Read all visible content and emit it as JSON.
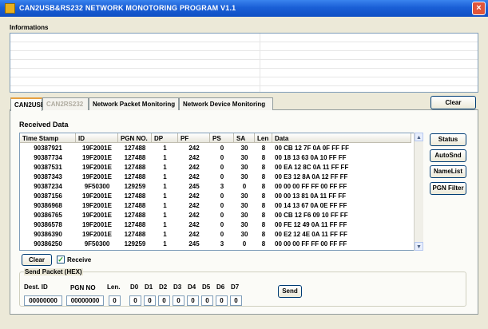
{
  "window": {
    "title": "CAN2USB&RS232 NETWORK MONOTORING PROGRAM V1.1",
    "close_glyph": "×"
  },
  "info": {
    "label": "Informations",
    "clear_label": "Clear"
  },
  "tabs": [
    {
      "label": "CAN2USB",
      "state": "active"
    },
    {
      "label": "CAN2RS232",
      "state": "disabled"
    },
    {
      "label": "Network Packet Monitoring",
      "state": "normal"
    },
    {
      "label": "Network Device Monitoring",
      "state": "normal"
    }
  ],
  "received": {
    "label": "Received Data",
    "columns": [
      "Time Stamp",
      "ID",
      "PGN NO.",
      "DP",
      "PF",
      "PS",
      "SA",
      "Len",
      "Data"
    ],
    "rows": [
      [
        "90387921",
        "19F2001E",
        "127488",
        "1",
        "242",
        "0",
        "30",
        "8",
        "00 CB 12 7F 0A 0F FF FF"
      ],
      [
        "90387734",
        "19F2001E",
        "127488",
        "1",
        "242",
        "0",
        "30",
        "8",
        "00 18 13 63 0A 10 FF FF"
      ],
      [
        "90387531",
        "19F2001E",
        "127488",
        "1",
        "242",
        "0",
        "30",
        "8",
        "00 EA 12 8C 0A 11 FF FF"
      ],
      [
        "90387343",
        "19F2001E",
        "127488",
        "1",
        "242",
        "0",
        "30",
        "8",
        "00 E3 12 8A 0A 12 FF FF"
      ],
      [
        "90387234",
        "9F50300",
        "129259",
        "1",
        "245",
        "3",
        "0",
        "8",
        "00 00 00 FF FF 00 FF FF"
      ],
      [
        "90387156",
        "19F2001E",
        "127488",
        "1",
        "242",
        "0",
        "30",
        "8",
        "00 00 13 81 0A 11 FF FF"
      ],
      [
        "90386968",
        "19F2001E",
        "127488",
        "1",
        "242",
        "0",
        "30",
        "8",
        "00 14 13 67 0A 0E FF FF"
      ],
      [
        "90386765",
        "19F2001E",
        "127488",
        "1",
        "242",
        "0",
        "30",
        "8",
        "00 CB 12 F6 09 10 FF FF"
      ],
      [
        "90386578",
        "19F2001E",
        "127488",
        "1",
        "242",
        "0",
        "30",
        "8",
        "00 FE 12 49 0A 11 FF FF"
      ],
      [
        "90386390",
        "19F2001E",
        "127488",
        "1",
        "242",
        "0",
        "30",
        "8",
        "00 E2 12 4E 0A 11 FF FF"
      ],
      [
        "90386250",
        "9F50300",
        "129259",
        "1",
        "245",
        "3",
        "0",
        "8",
        "00 00 00 FF FF 00 FF FF"
      ]
    ],
    "clear_label": "Clear",
    "receive_label": "Receive",
    "receive_checked": true
  },
  "side_buttons": [
    "Status",
    "AutoSnd",
    "NameList",
    "PGN Filter"
  ],
  "send": {
    "group_label": "Send Packet (HEX)",
    "dest_label": "Dest. ID",
    "pgn_label": "PGN NO",
    "len_label": "Len.",
    "byte_labels": [
      "D0",
      "D1",
      "D2",
      "D3",
      "D4",
      "D5",
      "D6",
      "D7"
    ],
    "dest_value": "00000000",
    "pgn_value": "00000000",
    "len_value": "0",
    "byte_values": [
      "0",
      "0",
      "0",
      "0",
      "0",
      "0",
      "0",
      "0"
    ],
    "send_label": "Send"
  }
}
